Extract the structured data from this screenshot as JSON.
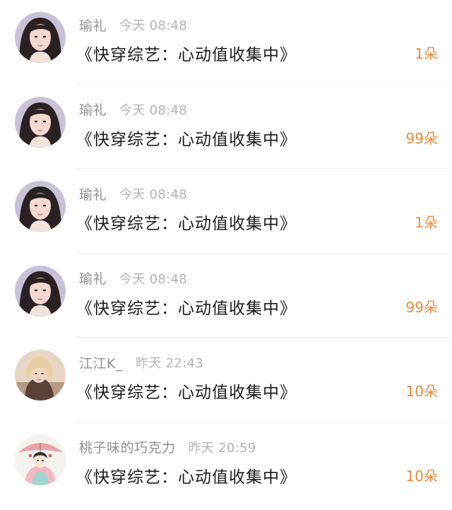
{
  "colors": {
    "username": "#8f8f8f",
    "time": "#b3b3b3",
    "book_title": "#1c1c1c",
    "amount": "#ef8a3b",
    "divider": "#f1f1f1"
  },
  "rows": [
    {
      "username": "瑜礼",
      "time": "今天 08:48",
      "book_title": "《快穿综艺：心动值收集中》",
      "amount": "1朵",
      "avatar_icon": "avatar-girl-dark-hair-icon"
    },
    {
      "username": "瑜礼",
      "time": "今天 08:48",
      "book_title": "《快穿综艺：心动值收集中》",
      "amount": "99朵",
      "avatar_icon": "avatar-girl-dark-hair-icon"
    },
    {
      "username": "瑜礼",
      "time": "今天 08:48",
      "book_title": "《快穿综艺：心动值收集中》",
      "amount": "1朵",
      "avatar_icon": "avatar-girl-dark-hair-icon"
    },
    {
      "username": "瑜礼",
      "time": "今天 08:48",
      "book_title": "《快穿综艺：心动值收集中》",
      "amount": "99朵",
      "avatar_icon": "avatar-girl-dark-hair-icon"
    },
    {
      "username": "江江K_",
      "time": "昨天 22:43",
      "book_title": "《快穿综艺：心动值收集中》",
      "amount": "10朵",
      "avatar_icon": "avatar-blonde-girl-icon"
    },
    {
      "username": "桃子味的巧克力",
      "time": "昨天 20:59",
      "book_title": "《快穿综艺：心动值收集中》",
      "amount": "10朵",
      "avatar_icon": "avatar-illustrated-girl-umbrella-icon"
    }
  ]
}
